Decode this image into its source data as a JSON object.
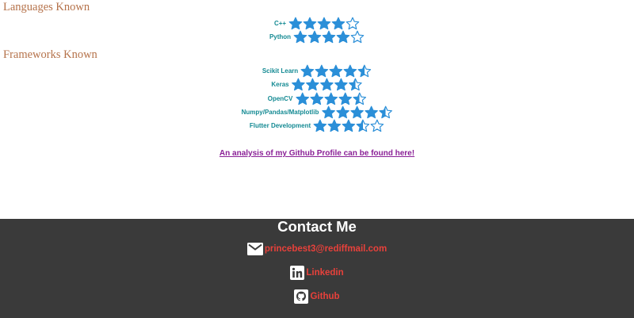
{
  "colors": {
    "heading": "#b5724a",
    "skill_label": "#148a93",
    "star": "#2b8fd8",
    "link": "#8a1f96",
    "footer_bg": "#3a3a3a",
    "footer_title": "#ffffff",
    "contact_text": "#e8413b"
  },
  "languages": {
    "heading": "Languages Known",
    "items": [
      {
        "label": "C++",
        "rating": 4
      },
      {
        "label": "Python",
        "rating": 4
      }
    ]
  },
  "frameworks": {
    "heading": "Frameworks Known",
    "items": [
      {
        "label": "Scikit Learn",
        "rating": 4.5
      },
      {
        "label": "Keras",
        "rating": 4.5
      },
      {
        "label": "OpenCV",
        "rating": 4.5
      },
      {
        "label": "Numpy/Pandas/Matplotlib",
        "rating": 4.5
      },
      {
        "label": "Flutter Development",
        "rating": 3.5
      }
    ]
  },
  "github_analysis_link": "An analysis of my Github Profile can be found here!",
  "footer": {
    "title": "Contact Me",
    "contacts": [
      {
        "icon": "email-icon",
        "text": "princebest3@rediffmail.com"
      },
      {
        "icon": "linkedin-icon",
        "text": "Linkedin"
      },
      {
        "icon": "github-icon",
        "text": "Github"
      }
    ]
  }
}
